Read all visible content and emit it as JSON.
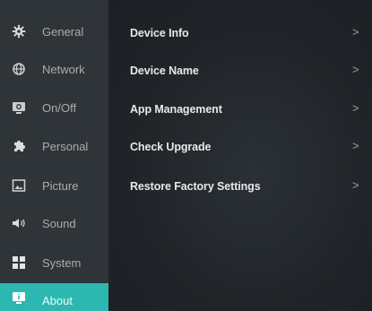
{
  "sidebar": {
    "items": [
      {
        "label": "General",
        "icon": "gear-icon"
      },
      {
        "label": "Network",
        "icon": "network-globe-icon"
      },
      {
        "label": "On/Off",
        "icon": "power-monitor-icon"
      },
      {
        "label": "Personal",
        "icon": "puzzle-icon"
      },
      {
        "label": "Picture",
        "icon": "picture-icon"
      },
      {
        "label": "Sound",
        "icon": "speaker-icon"
      },
      {
        "label": "System",
        "icon": "grid-icon"
      },
      {
        "label": "About",
        "icon": "info-monitor-icon"
      }
    ],
    "active_index": 7
  },
  "main": {
    "rows": [
      {
        "label": "Device Info",
        "chevron": ">"
      },
      {
        "label": "Device Name",
        "chevron": ">"
      },
      {
        "label": "App Management",
        "chevron": ">"
      },
      {
        "label": "Check Upgrade",
        "chevron": ">"
      },
      {
        "label": "Restore Factory Settings",
        "chevron": ">"
      }
    ]
  },
  "colors": {
    "sidebar_bg": "#2f3438",
    "content_bg": "#1f2327",
    "accent": "#2cb8b0"
  }
}
